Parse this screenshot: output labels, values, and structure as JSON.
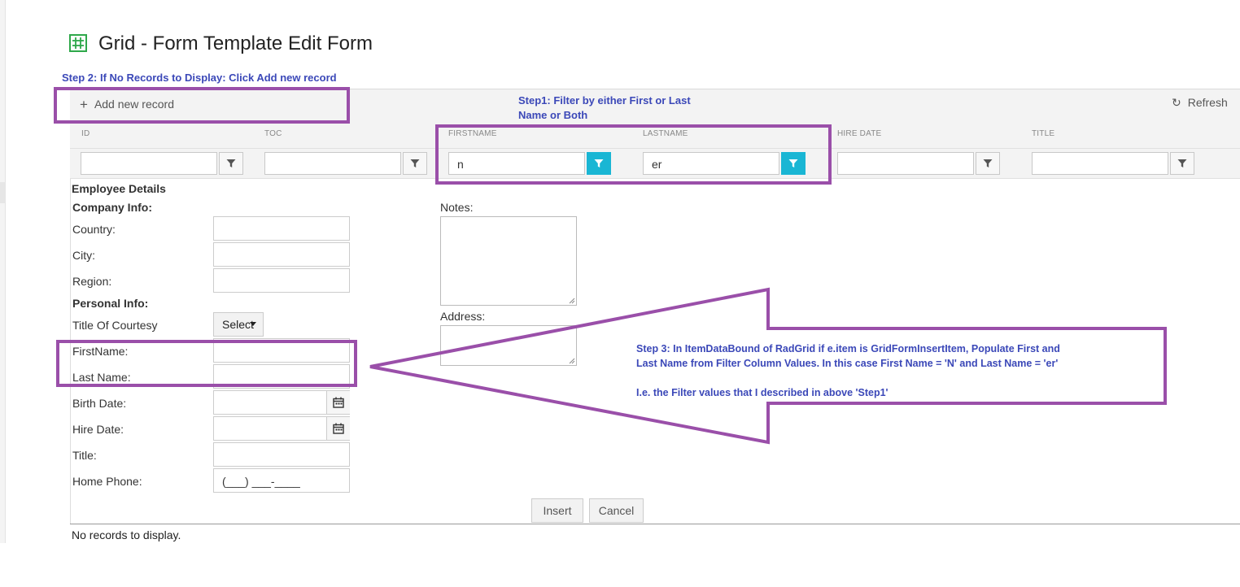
{
  "page": {
    "title": "Grid - Form Template Edit Form"
  },
  "annotations": {
    "step2": "Step 2: If No Records to Display: Click Add new record",
    "step1_line1": "Step1: Filter by either First or Last",
    "step1_line2": "Name or Both",
    "step3_line1": "Step 3: In ItemDataBound of RadGrid if e.item is GridFormInsertItem, Populate First and",
    "step3_line2": "Last Name  from Filter Column Values. In this case First Name = 'N' and Last Name = 'er'",
    "step3_line3": "I.e. the Filter values that I described in above 'Step1'"
  },
  "toolbar": {
    "add_label": "Add new record",
    "refresh_label": "Refresh"
  },
  "columns": [
    {
      "header": "ID",
      "filter_value": ""
    },
    {
      "header": "TOC",
      "filter_value": ""
    },
    {
      "header": "FIRSTNAME",
      "filter_value": "n"
    },
    {
      "header": "LASTNAME",
      "filter_value": "er"
    },
    {
      "header": "HIRE DATE",
      "filter_value": ""
    },
    {
      "header": "TITLE",
      "filter_value": ""
    }
  ],
  "form": {
    "section_title": "Employee Details",
    "company_info": "Company Info:",
    "country": "Country:",
    "city": "City:",
    "region": "Region:",
    "personal_info": "Personal Info:",
    "title_of_courtesy": "Title Of Courtesy",
    "select_label": "Select",
    "first_name": "FirstName:",
    "last_name": "Last Name:",
    "birth_date": "Birth Date:",
    "hire_date": "Hire Date:",
    "title": "Title:",
    "home_phone": "Home Phone:",
    "home_phone_mask": "(___) ___-____",
    "notes": "Notes:",
    "address": "Address:",
    "insert_label": "Insert",
    "cancel_label": "Cancel"
  },
  "status": {
    "no_records": "No records to display."
  },
  "colors": {
    "annotation_text": "#3b48b8",
    "highlight_box": "#9a4fa9",
    "active_filter": "#1ab6d4",
    "grid_icon": "#2ea84a"
  }
}
